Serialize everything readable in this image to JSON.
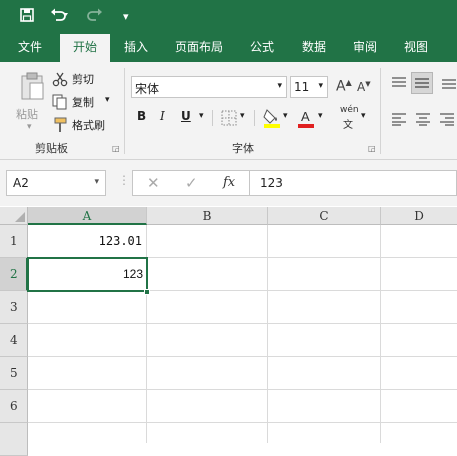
{
  "quick_access": {
    "save": "save-icon",
    "undo": "undo-icon",
    "redo": "redo-icon",
    "customize": "▾"
  },
  "tabs": [
    {
      "label": "文件"
    },
    {
      "label": "开始"
    },
    {
      "label": "插入"
    },
    {
      "label": "页面布局"
    },
    {
      "label": "公式"
    },
    {
      "label": "数据"
    },
    {
      "label": "审阅"
    },
    {
      "label": "视图"
    }
  ],
  "clipboard": {
    "paste": "粘贴",
    "cut": "剪切",
    "copy": "复制",
    "format_painter": "格式刷",
    "group_label": "剪贴板"
  },
  "font": {
    "name": "宋体",
    "size": "11",
    "group_label": "字体",
    "bold": "B",
    "italic": "I",
    "underline": "U",
    "grow": "A",
    "shrink": "A",
    "phonetic": "wén"
  },
  "formula_bar": {
    "name_box": "A2",
    "fx": "fx",
    "value": "123"
  },
  "grid": {
    "columns": [
      "A",
      "B",
      "C",
      "D"
    ],
    "rows": [
      "1",
      "2",
      "3",
      "4",
      "5",
      "6"
    ],
    "cells": {
      "A1": "123.01",
      "A2": "123"
    }
  },
  "colors": {
    "accent": "#217346"
  }
}
